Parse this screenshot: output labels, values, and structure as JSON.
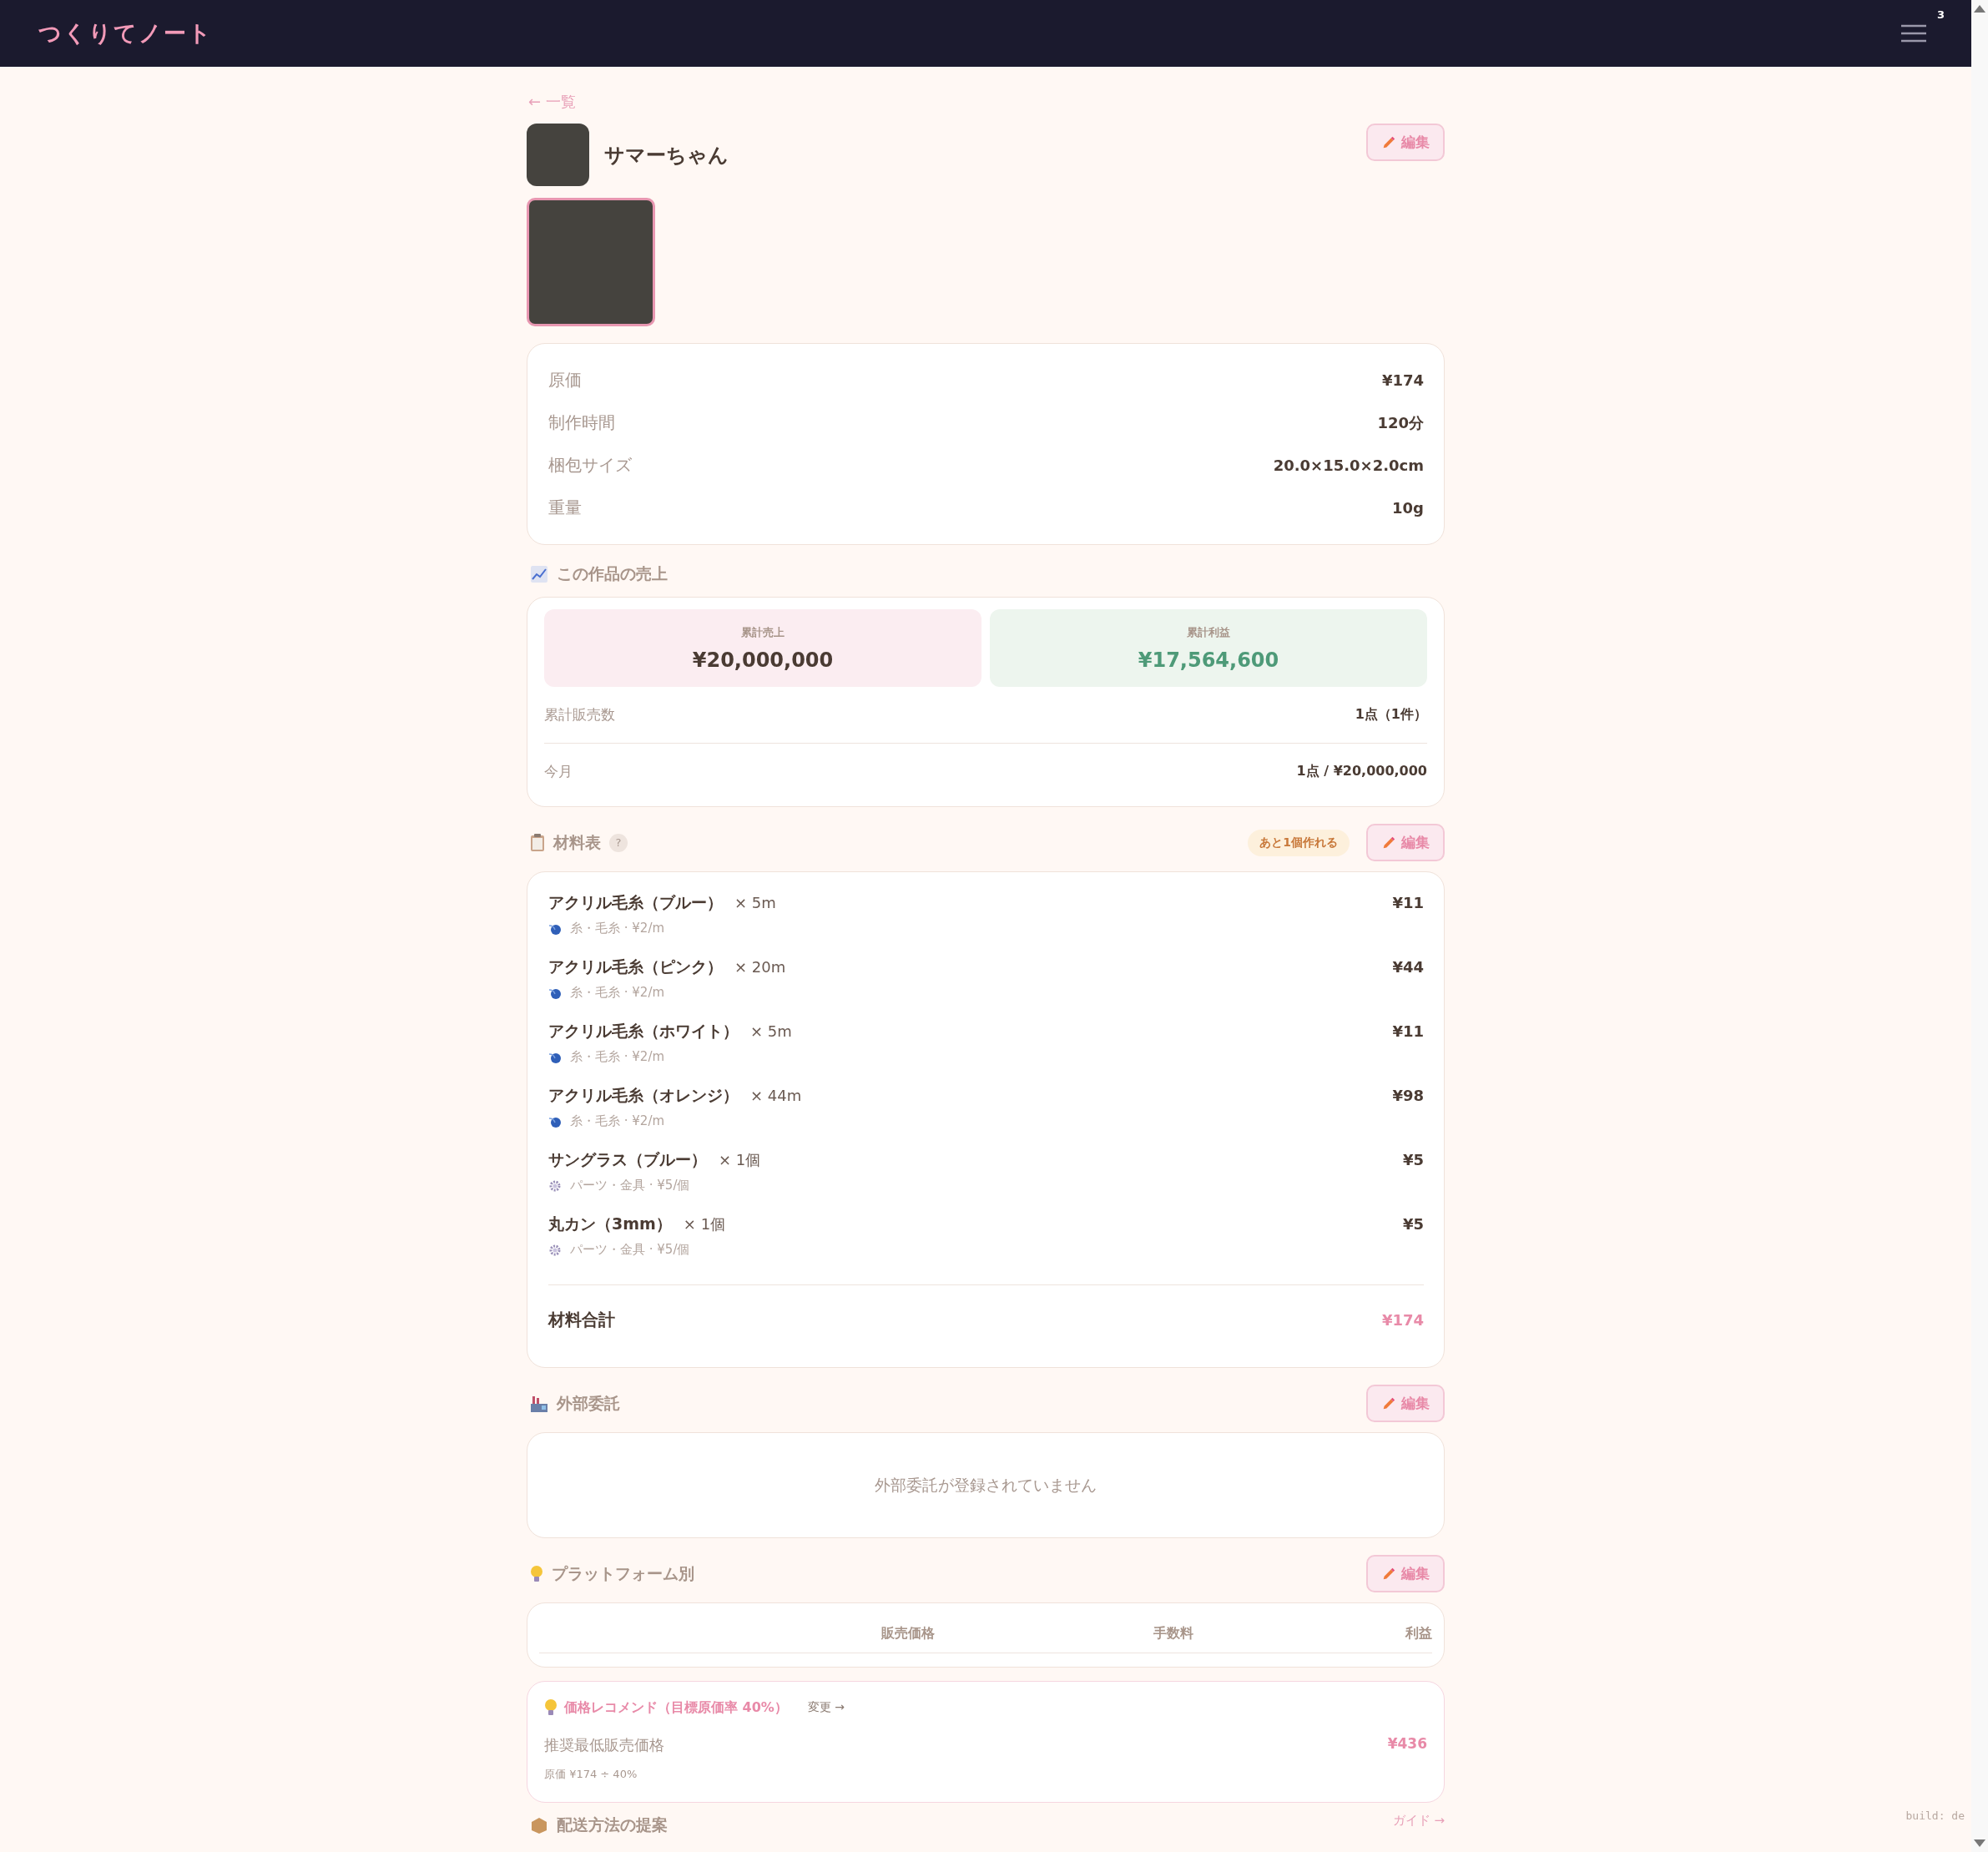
{
  "app_bar": {
    "title": "つくりてノート",
    "menu_badge": "3"
  },
  "back_link": "← 一覧",
  "product": {
    "name": "サマーちゃん",
    "edit_button": "編集"
  },
  "details": [
    {
      "label": "原価",
      "value": "¥174"
    },
    {
      "label": "制作時間",
      "value": "120分"
    },
    {
      "label": "梱包サイズ",
      "value": "20.0×15.0×2.0cm"
    },
    {
      "label": "重量",
      "value": "10g"
    }
  ],
  "sales": {
    "title": "この作品の売上",
    "totals": [
      {
        "label": "累計売上",
        "value": "¥20,000,000",
        "kind": "sales"
      },
      {
        "label": "累計利益",
        "value": "¥17,564,600",
        "kind": "profit"
      }
    ],
    "rows": [
      {
        "label": "累計販売数",
        "value": "1点（1件）"
      },
      {
        "label": "今月",
        "value": "1点 / ¥20,000,000"
      }
    ]
  },
  "materials": {
    "title": "材料表",
    "help": "?",
    "stock_badge": "あと1個作れる",
    "edit_button": "編集",
    "items": [
      {
        "name": "アクリル毛糸（ブルー）",
        "quantity": "× 5m",
        "meta": "糸・毛糸 · ¥2/m",
        "price": "¥11",
        "kind": "yarn"
      },
      {
        "name": "アクリル毛糸（ピンク）",
        "quantity": "× 20m",
        "meta": "糸・毛糸 · ¥2/m",
        "price": "¥44",
        "kind": "yarn"
      },
      {
        "name": "アクリル毛糸（ホワイト）",
        "quantity": "× 5m",
        "meta": "糸・毛糸 · ¥2/m",
        "price": "¥11",
        "kind": "yarn"
      },
      {
        "name": "アクリル毛糸（オレンジ）",
        "quantity": "× 44m",
        "meta": "糸・毛糸 · ¥2/m",
        "price": "¥98",
        "kind": "yarn"
      },
      {
        "name": "サングラス（ブルー）",
        "quantity": "× 1個",
        "meta": "パーツ・金具 · ¥5/個",
        "price": "¥5",
        "kind": "parts"
      },
      {
        "name": "丸カン（3mm）",
        "quantity": "× 1個",
        "meta": "パーツ・金具 · ¥5/個",
        "price": "¥5",
        "kind": "parts"
      }
    ],
    "total_label": "材料合計",
    "total_value": "¥174"
  },
  "outsourcing": {
    "title": "外部委託",
    "edit_button": "編集",
    "empty_message": "外部委託が登録されていません"
  },
  "platforms": {
    "title": "プラットフォーム別",
    "edit_button": "編集",
    "columns": [
      "販売価格",
      "手数料",
      "利益"
    ]
  },
  "recommendation": {
    "title": "価格レコメンド（目標原価率 40%）",
    "change_link": "変更 →",
    "label": "推奨最低販売価格",
    "value": "¥436",
    "formula": "原価 ¥174 ÷ 40%"
  },
  "shipping": {
    "title": "配送方法の提案",
    "guide_link": "ガイド →"
  },
  "build_label": "build: de"
}
